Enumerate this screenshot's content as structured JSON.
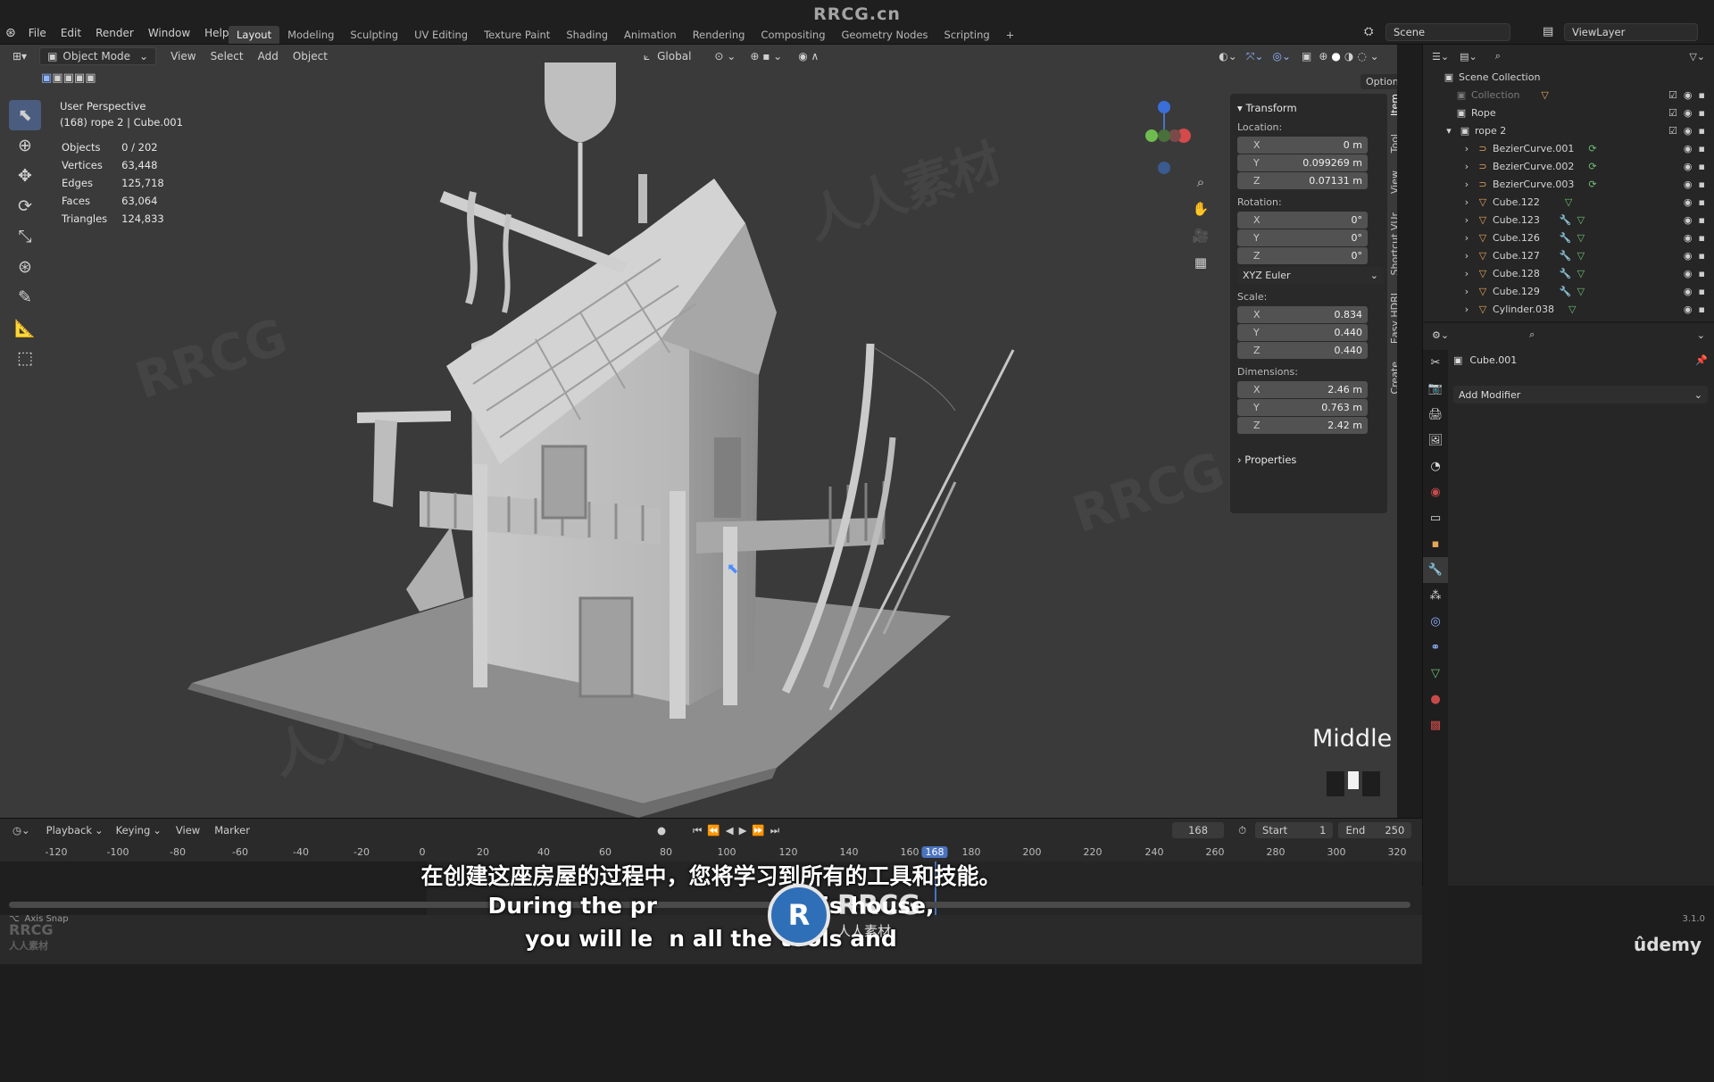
{
  "app_title": "RRCG.cn",
  "menus": [
    "File",
    "Edit",
    "Render",
    "Window",
    "Help"
  ],
  "workspaces": [
    "Layout",
    "Modeling",
    "Sculpting",
    "UV Editing",
    "Texture Paint",
    "Shading",
    "Animation",
    "Rendering",
    "Compositing",
    "Geometry Nodes",
    "Scripting"
  ],
  "scene": {
    "scene_name": "Scene",
    "view_layer": "ViewLayer"
  },
  "viewport": {
    "mode": "Object Mode",
    "menu": [
      "View",
      "Select",
      "Add",
      "Object"
    ],
    "orientation": "Global",
    "options": "Options",
    "overlay_title": "User Perspective",
    "overlay_subtitle": "(168) rope 2 | Cube.001",
    "stats": [
      {
        "label": "Objects",
        "value": "0 / 202"
      },
      {
        "label": "Vertices",
        "value": "63,448"
      },
      {
        "label": "Edges",
        "value": "125,718"
      },
      {
        "label": "Faces",
        "value": "63,064"
      },
      {
        "label": "Triangles",
        "value": "124,833"
      }
    ],
    "key_indicator": "Middle"
  },
  "n_panel": {
    "section": "Transform",
    "location_label": "Location:",
    "location": [
      {
        "axis": "X",
        "value": "0 m"
      },
      {
        "axis": "Y",
        "value": "0.099269 m"
      },
      {
        "axis": "Z",
        "value": "0.07131 m"
      }
    ],
    "rotation_label": "Rotation:",
    "rotation": [
      {
        "axis": "X",
        "value": "0°"
      },
      {
        "axis": "Y",
        "value": "0°"
      },
      {
        "axis": "Z",
        "value": "0°"
      }
    ],
    "rotation_mode": "XYZ Euler",
    "scale_label": "Scale:",
    "scale": [
      {
        "axis": "X",
        "value": "0.834"
      },
      {
        "axis": "Y",
        "value": "0.440"
      },
      {
        "axis": "Z",
        "value": "0.440"
      }
    ],
    "dimensions_label": "Dimensions:",
    "dimensions": [
      {
        "axis": "X",
        "value": "2.46 m"
      },
      {
        "axis": "Y",
        "value": "0.763 m"
      },
      {
        "axis": "Z",
        "value": "2.42 m"
      }
    ],
    "properties": "Properties",
    "tabs": [
      "Item",
      "Tool",
      "View",
      "Shortcut VUr",
      "Easy HDRI",
      "Create"
    ]
  },
  "outliner": {
    "root": "Scene Collection",
    "items": [
      {
        "name": "Collection",
        "type": "collection"
      },
      {
        "name": "Rope",
        "type": "collection"
      },
      {
        "name": "rope 2",
        "type": "collection"
      },
      {
        "name": "BezierCurve.001",
        "type": "curve"
      },
      {
        "name": "BezierCurve.002",
        "type": "curve"
      },
      {
        "name": "BezierCurve.003",
        "type": "curve"
      },
      {
        "name": "Cube.122",
        "type": "mesh"
      },
      {
        "name": "Cube.123",
        "type": "mesh"
      },
      {
        "name": "Cube.126",
        "type": "mesh"
      },
      {
        "name": "Cube.127",
        "type": "mesh"
      },
      {
        "name": "Cube.128",
        "type": "mesh"
      },
      {
        "name": "Cube.129",
        "type": "mesh"
      },
      {
        "name": "Cylinder.038",
        "type": "mesh"
      }
    ]
  },
  "properties": {
    "object_name": "Cube.001",
    "add_modifier": "Add Modifier"
  },
  "timeline": {
    "menu": [
      "Playback",
      "Keying",
      "View",
      "Marker"
    ],
    "current_frame": "168",
    "start_label": "Start",
    "start": "1",
    "end_label": "End",
    "end": "250",
    "ruler": [
      "-120",
      "-100",
      "-80",
      "-60",
      "-40",
      "-20",
      "0",
      "20",
      "40",
      "60",
      "80",
      "100",
      "120",
      "140",
      "160",
      "168",
      "180",
      "200",
      "220",
      "240",
      "260",
      "280",
      "300",
      "320"
    ]
  },
  "status": {
    "axis_snap": "Axis Snap",
    "version": "3.1.0",
    "brand": "ûdemy"
  },
  "subtitles": {
    "chinese": "在创建这座房屋的过程中，您将学习到所有的工具和技能。",
    "english_line1": "During the pr",
    "english_line1_end": "g this house,",
    "english_line2": "you will le",
    "english_line2_end": "n all the tools and"
  },
  "watermark": {
    "brand": "RRCG",
    "sub": "人人素材"
  },
  "colors": {
    "accent": "#4a73c0",
    "active_tool": "#4a5d80",
    "mesh_icon": "#6fbf73",
    "curve_icon": "#e7a55a"
  }
}
